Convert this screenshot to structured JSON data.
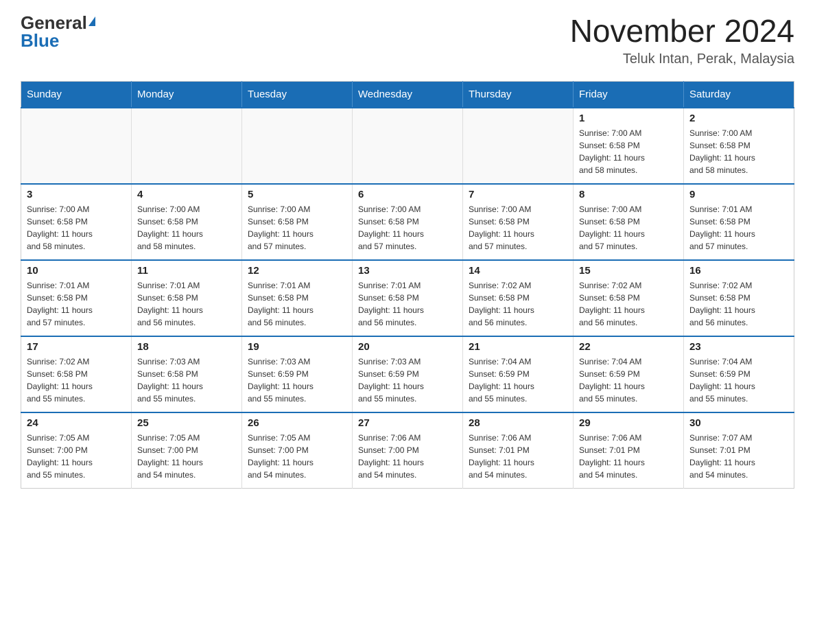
{
  "header": {
    "logo_general": "General",
    "logo_blue": "Blue",
    "month_title": "November 2024",
    "location": "Teluk Intan, Perak, Malaysia"
  },
  "days_of_week": [
    "Sunday",
    "Monday",
    "Tuesday",
    "Wednesday",
    "Thursday",
    "Friday",
    "Saturday"
  ],
  "weeks": [
    [
      {
        "day": "",
        "info": ""
      },
      {
        "day": "",
        "info": ""
      },
      {
        "day": "",
        "info": ""
      },
      {
        "day": "",
        "info": ""
      },
      {
        "day": "",
        "info": ""
      },
      {
        "day": "1",
        "info": "Sunrise: 7:00 AM\nSunset: 6:58 PM\nDaylight: 11 hours\nand 58 minutes."
      },
      {
        "day": "2",
        "info": "Sunrise: 7:00 AM\nSunset: 6:58 PM\nDaylight: 11 hours\nand 58 minutes."
      }
    ],
    [
      {
        "day": "3",
        "info": "Sunrise: 7:00 AM\nSunset: 6:58 PM\nDaylight: 11 hours\nand 58 minutes."
      },
      {
        "day": "4",
        "info": "Sunrise: 7:00 AM\nSunset: 6:58 PM\nDaylight: 11 hours\nand 58 minutes."
      },
      {
        "day": "5",
        "info": "Sunrise: 7:00 AM\nSunset: 6:58 PM\nDaylight: 11 hours\nand 57 minutes."
      },
      {
        "day": "6",
        "info": "Sunrise: 7:00 AM\nSunset: 6:58 PM\nDaylight: 11 hours\nand 57 minutes."
      },
      {
        "day": "7",
        "info": "Sunrise: 7:00 AM\nSunset: 6:58 PM\nDaylight: 11 hours\nand 57 minutes."
      },
      {
        "day": "8",
        "info": "Sunrise: 7:00 AM\nSunset: 6:58 PM\nDaylight: 11 hours\nand 57 minutes."
      },
      {
        "day": "9",
        "info": "Sunrise: 7:01 AM\nSunset: 6:58 PM\nDaylight: 11 hours\nand 57 minutes."
      }
    ],
    [
      {
        "day": "10",
        "info": "Sunrise: 7:01 AM\nSunset: 6:58 PM\nDaylight: 11 hours\nand 57 minutes."
      },
      {
        "day": "11",
        "info": "Sunrise: 7:01 AM\nSunset: 6:58 PM\nDaylight: 11 hours\nand 56 minutes."
      },
      {
        "day": "12",
        "info": "Sunrise: 7:01 AM\nSunset: 6:58 PM\nDaylight: 11 hours\nand 56 minutes."
      },
      {
        "day": "13",
        "info": "Sunrise: 7:01 AM\nSunset: 6:58 PM\nDaylight: 11 hours\nand 56 minutes."
      },
      {
        "day": "14",
        "info": "Sunrise: 7:02 AM\nSunset: 6:58 PM\nDaylight: 11 hours\nand 56 minutes."
      },
      {
        "day": "15",
        "info": "Sunrise: 7:02 AM\nSunset: 6:58 PM\nDaylight: 11 hours\nand 56 minutes."
      },
      {
        "day": "16",
        "info": "Sunrise: 7:02 AM\nSunset: 6:58 PM\nDaylight: 11 hours\nand 56 minutes."
      }
    ],
    [
      {
        "day": "17",
        "info": "Sunrise: 7:02 AM\nSunset: 6:58 PM\nDaylight: 11 hours\nand 55 minutes."
      },
      {
        "day": "18",
        "info": "Sunrise: 7:03 AM\nSunset: 6:58 PM\nDaylight: 11 hours\nand 55 minutes."
      },
      {
        "day": "19",
        "info": "Sunrise: 7:03 AM\nSunset: 6:59 PM\nDaylight: 11 hours\nand 55 minutes."
      },
      {
        "day": "20",
        "info": "Sunrise: 7:03 AM\nSunset: 6:59 PM\nDaylight: 11 hours\nand 55 minutes."
      },
      {
        "day": "21",
        "info": "Sunrise: 7:04 AM\nSunset: 6:59 PM\nDaylight: 11 hours\nand 55 minutes."
      },
      {
        "day": "22",
        "info": "Sunrise: 7:04 AM\nSunset: 6:59 PM\nDaylight: 11 hours\nand 55 minutes."
      },
      {
        "day": "23",
        "info": "Sunrise: 7:04 AM\nSunset: 6:59 PM\nDaylight: 11 hours\nand 55 minutes."
      }
    ],
    [
      {
        "day": "24",
        "info": "Sunrise: 7:05 AM\nSunset: 7:00 PM\nDaylight: 11 hours\nand 55 minutes."
      },
      {
        "day": "25",
        "info": "Sunrise: 7:05 AM\nSunset: 7:00 PM\nDaylight: 11 hours\nand 54 minutes."
      },
      {
        "day": "26",
        "info": "Sunrise: 7:05 AM\nSunset: 7:00 PM\nDaylight: 11 hours\nand 54 minutes."
      },
      {
        "day": "27",
        "info": "Sunrise: 7:06 AM\nSunset: 7:00 PM\nDaylight: 11 hours\nand 54 minutes."
      },
      {
        "day": "28",
        "info": "Sunrise: 7:06 AM\nSunset: 7:01 PM\nDaylight: 11 hours\nand 54 minutes."
      },
      {
        "day": "29",
        "info": "Sunrise: 7:06 AM\nSunset: 7:01 PM\nDaylight: 11 hours\nand 54 minutes."
      },
      {
        "day": "30",
        "info": "Sunrise: 7:07 AM\nSunset: 7:01 PM\nDaylight: 11 hours\nand 54 minutes."
      }
    ]
  ]
}
